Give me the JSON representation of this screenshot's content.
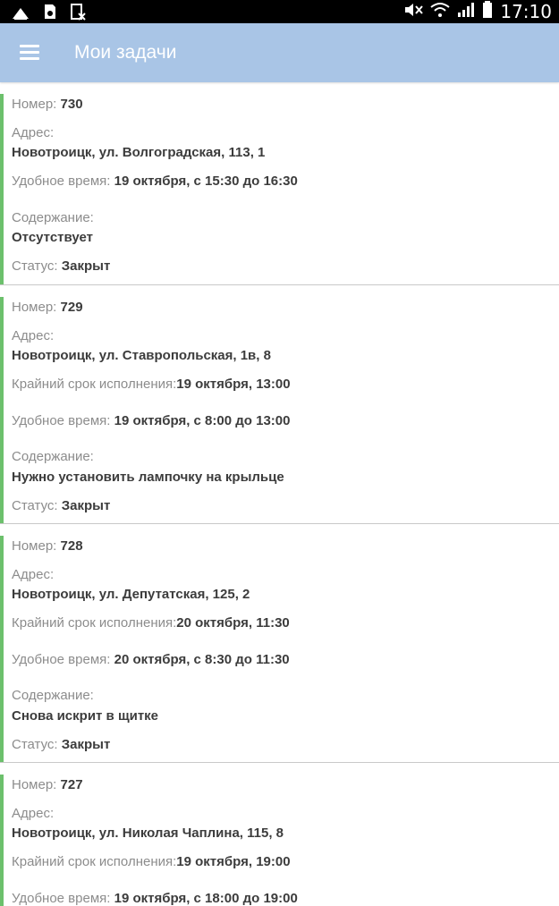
{
  "statusbar": {
    "time": "17:10",
    "left_icons": [
      "android-icon",
      "sd-card-icon",
      "sim-off-icon"
    ],
    "right_icons": [
      "mute-icon",
      "wifi-icon",
      "signal-icon",
      "battery-icon"
    ]
  },
  "appbar": {
    "title": "Мои задачи",
    "menu_icon": "hamburger-icon"
  },
  "labels": {
    "number": "Номер:",
    "address": "Адрес:",
    "deadline": "Крайний срок исполнения:",
    "convenient": "Удобное время:",
    "content": "Содержание:",
    "status": "Статус:"
  },
  "tasks": [
    {
      "number": "730",
      "address": "Новотроицк, ул. Волгоградская, 113, 1",
      "convenient": "19 октября, с 15:30 до 16:30",
      "content": "Отсутствует",
      "status": "Закрыт"
    },
    {
      "number": "729",
      "address": "Новотроицк, ул. Ставропольская, 1в, 8",
      "deadline": "19 октября, 13:00",
      "convenient": "19 октября, с 8:00 до 13:00",
      "content": "Нужно установить лампочку на крыльце",
      "status": "Закрыт"
    },
    {
      "number": "728",
      "address": "Новотроицк, ул. Депутатская, 125, 2",
      "deadline": "20 октября, 11:30",
      "convenient": "20 октября, с 8:30 до 11:30",
      "content": "Снова искрит в щитке",
      "status": "Закрыт"
    },
    {
      "number": "727",
      "address": "Новотроицк, ул. Николая Чаплина, 115, 8",
      "deadline": "19 октября, 19:00",
      "convenient": "19 октября, с 18:00 до 19:00"
    }
  ],
  "colors": {
    "appbar": "#a9c5e6",
    "accent_bar": "#6cc06c",
    "divider": "#c9c9c9"
  }
}
